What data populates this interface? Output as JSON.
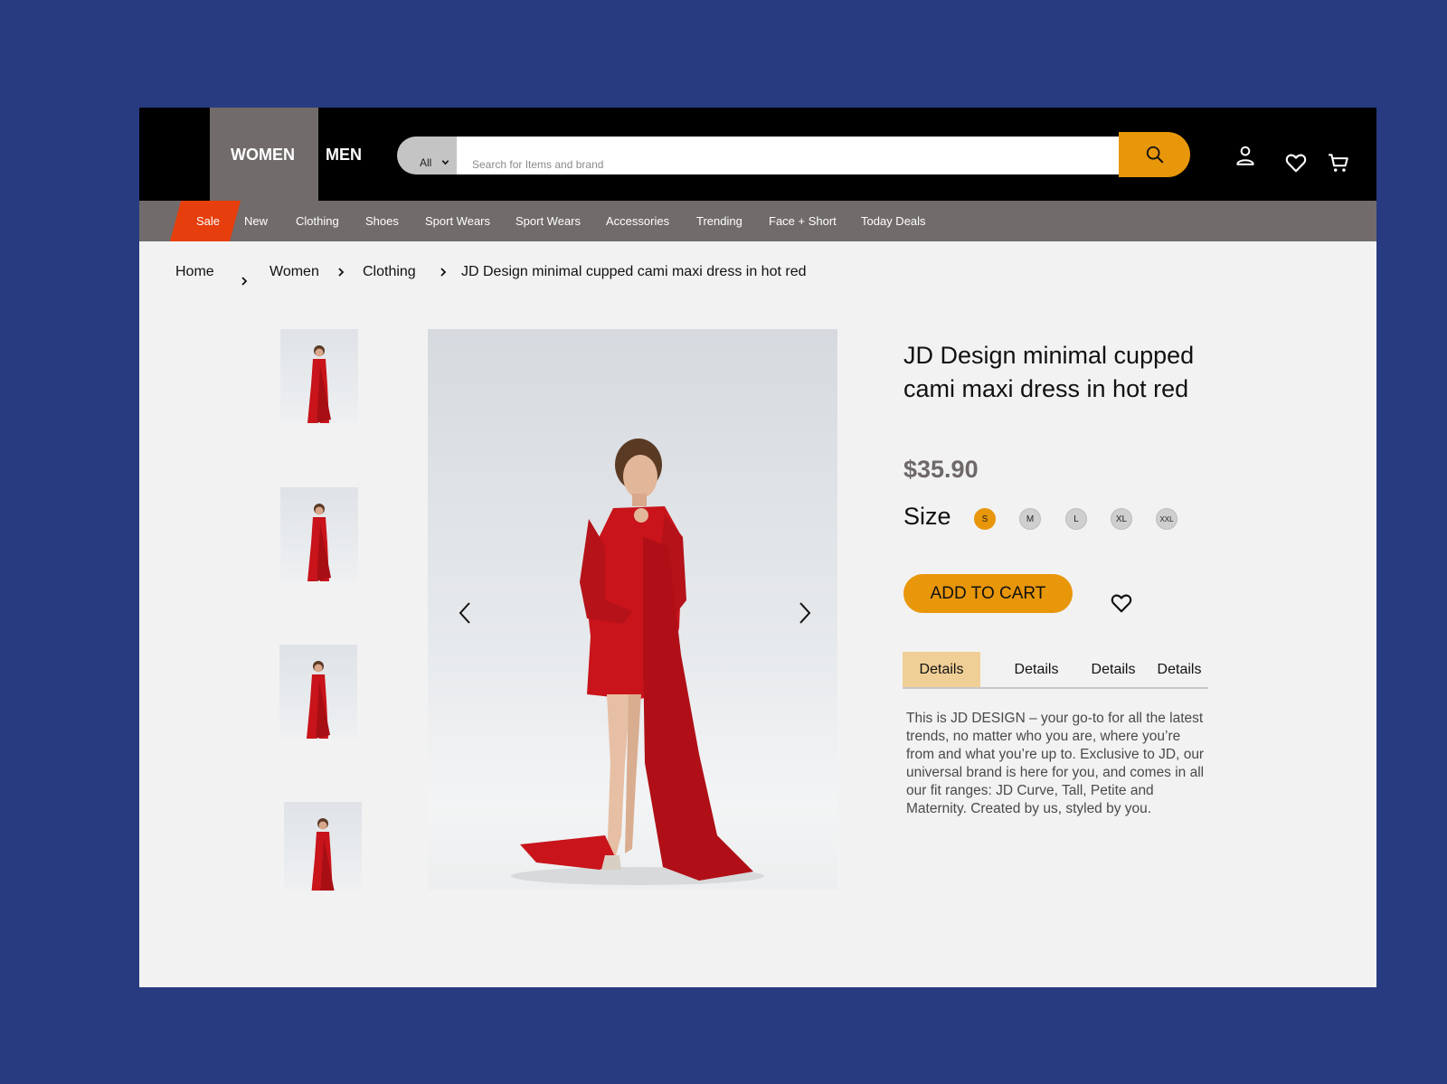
{
  "header": {
    "gender_tabs": [
      "WOMEN",
      "MEN"
    ],
    "search": {
      "category": "All",
      "placeholder": "Search for Items and brand"
    }
  },
  "nav": {
    "items": [
      "Sale",
      "New",
      "Clothing",
      "Shoes",
      "Sport Wears",
      "Sport Wears",
      "Accessories",
      "Trending",
      "Face + Short",
      "Today Deals"
    ]
  },
  "breadcrumb": [
    "Home",
    "Women",
    "Clothing",
    "JD Design minimal cupped cami maxi dress in hot red"
  ],
  "product": {
    "title": "JD Design minimal cupped cami maxi dress in hot red",
    "price": "$35.90",
    "size_label": "Size",
    "sizes": [
      "S",
      "M",
      "L",
      "XL",
      "XXL"
    ],
    "selected_size": "S",
    "add_to_cart": "ADD TO CART",
    "tabs": [
      "Details",
      "Details",
      "Details",
      "Details"
    ],
    "active_tab": 0,
    "description": "This is JD DESIGN – your go-to for all the latest trends, no matter who you are, where you’re from and what you’re up to. Exclusive to JD, our universal brand is here for you, and comes in all our fit ranges: JD Curve, Tall, Petite and Maternity. Created by us, styled by you."
  },
  "colors": {
    "page_background": "#283b80",
    "accent": "#e8960a",
    "sale": "#e63e0c",
    "nav_gray": "#716b6b",
    "active_tab": "#f0cf96"
  },
  "icons": [
    "chevron-down-icon",
    "search-icon",
    "user-icon",
    "heart-icon",
    "cart-icon",
    "chevron-right-icon",
    "arrow-left-icon",
    "arrow-right-icon"
  ]
}
